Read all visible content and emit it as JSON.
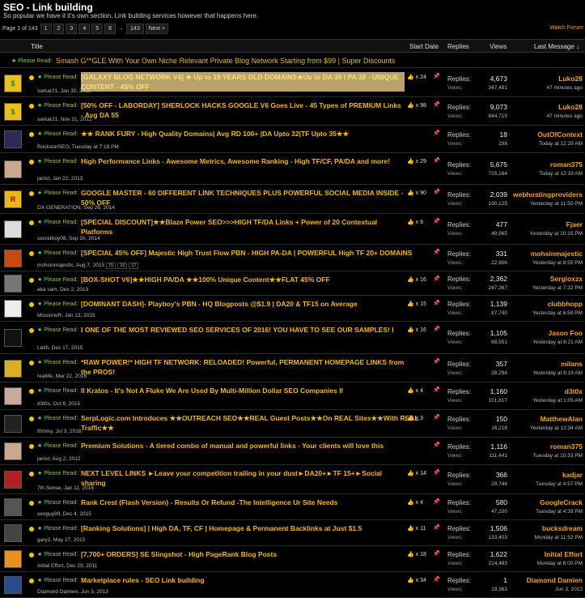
{
  "header": {
    "title": "SEO - Link building",
    "subtitle": "So popular we have it it's own section. Link building services however that happens here.",
    "pager_label": "Page 1 of 143",
    "pages": [
      "1",
      "2",
      "3",
      "4",
      "5",
      "6",
      "→",
      "143",
      "Next >"
    ],
    "watch": "Watch Forum"
  },
  "columns": {
    "title": "Title",
    "start": "Start Date",
    "replies": "Replies",
    "views": "Views",
    "last": "Last Message ↓"
  },
  "sticky_top": {
    "prefix": "Please Read:",
    "text": "Smash G**GLE With Your Own Niche Relevant Private Blog Network Starting from $99 | Super Discounts"
  },
  "labels": {
    "replies": "Replies:",
    "views": "Views:",
    "please_read": "Please Read:"
  },
  "threads": [
    {
      "title": "[GALAXY BLOG NETWORK V4] ★ Up to 19 YEARS OLD DOMAINS★Up to DA 39 | PA 38 - UNIQUE CONTENT - 45% OFF",
      "meta": "sarkar21, Jan 30, 2013",
      "likes": "x 24",
      "replies": "4,673",
      "views": "347,481",
      "last_user": "Luko28",
      "last_time": "47 minutes ago",
      "avatar": "$",
      "avatar_color": "#e8c21a",
      "highlight": true
    },
    {
      "title": "[50% OFF - LABORDAY] SHERLOCK HACKS GOOGLE V6 Goes Live - 45 Types of PREMIUM Links - Avg DA 55",
      "meta": "sarkar21, Nov 21, 2012",
      "likes": "x 98",
      "replies": "9,073",
      "views": "844,715",
      "last_user": "Luko28",
      "last_time": "47 minutes ago",
      "avatar": "$",
      "avatar_color": "#e8c21a",
      "highlight": false
    },
    {
      "title": "★★ RANK FURY - High Quality Domains| Avg RD 100+ |DA Upto 32|TF Upto 35★★",
      "meta": "RockstarSEO, Tuesday at 7:18 PM",
      "likes": "",
      "replies": "18",
      "views": "298",
      "last_user": "OutOfContext",
      "last_time": "Today at 12:29 AM",
      "avatar": "",
      "avatar_color": "#2a2a55",
      "highlight": false
    },
    {
      "title": "High Performance Links - Awesome Metrics, Awesome Ranking - High TF/CF, PA/DA and more!",
      "meta": "janist, Jan 22, 2013",
      "likes": "x 29",
      "replies": "5,675",
      "views": "715,164",
      "last_user": "roman375",
      "last_time": "Today at 12:19 AM",
      "avatar": "",
      "avatar_color": "#c9a890",
      "highlight": false
    },
    {
      "title": "GOOGLE MASTER - 60 DIFFERENT LINK TECHNIQUES PLUS POWERFUL SOCIAL MEDIA INSIDE - 50% OFF",
      "meta": "DX-GENERATION, Sep 26, 2014",
      "likes": "x 90",
      "replies": "2,039",
      "views": "190,125",
      "last_user": "webhostingproviders",
      "last_time": "Yesterday at 11:50 PM",
      "avatar": "R",
      "avatar_color": "#e8b81a",
      "highlight": false
    },
    {
      "title": "[SPECIAL DISCOUNT]★★Blaze Power SEO>>>HIGH TF/DA Links + Power of 20 Contextual Platforms",
      "meta": "secretboy08, Sep 20, 2014",
      "likes": "x 6",
      "replies": "477",
      "views": "49,965",
      "last_user": "Fjaer",
      "last_time": "Yesterday at 10:15 PM",
      "avatar": "",
      "avatar_color": "#ddd",
      "highlight": false
    },
    {
      "title": "[SPECIAL 45% OFF] Majestic High Trust Flow PBN - HIGH PA-DA | POWERFUL High TF 20+ DOMAINS",
      "meta": "mohsinmajestic, Aug 7, 2015",
      "meta_pages": [
        "15",
        "16",
        "17"
      ],
      "likes": "",
      "replies": "331",
      "views": "22,906",
      "last_user": "mohsinmajestic",
      "last_time": "Yesterday at 8:55 PM",
      "avatar": "",
      "avatar_color": "#c84a10",
      "highlight": false
    },
    {
      "title": "[BOX-SHOT V6]★★HIGH PA/DA ★★100% Unique Content★★FLAT 45% OFF",
      "meta": "aka sam, Dec 2, 2013",
      "likes": "x 16",
      "replies": "2,362",
      "views": "247,367",
      "last_user": "Sergioxzx",
      "last_time": "Yesterday at 7:32 PM",
      "avatar": "",
      "avatar_color": "#777",
      "highlight": false
    },
    {
      "title": "[DOMINANT DASH]- Playboy's PBN - HQ Blogposts @$1.9 | DA20 & TF15 on Average",
      "meta": "MissioneR, Jan 13, 2015",
      "likes": "x 15",
      "replies": "1,139",
      "views": "87,740",
      "last_user": "clubbhopp",
      "last_time": "Yesterday at 6:59 PM",
      "avatar": "",
      "avatar_color": "#eee",
      "highlight": false
    },
    {
      "title": "I ONE OF THE MOST REVIEWED SEO SERVICES OF 2016! YOU HAVE TO SEE OUR SAMPLES! I",
      "meta": "Leith, Dec 17, 2015",
      "likes": "x 16",
      "replies": "1,105",
      "views": "88,551",
      "last_user": "Jason Foo",
      "last_time": "Yesterday at 6:21 AM",
      "avatar": "",
      "avatar_color": "#111",
      "highlight": false
    },
    {
      "title": "*RAW POWER!* HIGH TF NETWORK: RELOADED! Powerful, PERMANENT HOMEPAGE LINKS from the PROS!",
      "meta": "reallife, Mar 22, 2016",
      "likes": "",
      "replies": "357",
      "views": "28,294",
      "last_user": "milans",
      "last_time": "Yesterday at 6:19 AM",
      "avatar": "",
      "avatar_color": "#d9b020",
      "highlight": false
    },
    {
      "title": "Il Kratos - It's Not A Fluke We Are Used By Multi-Million Dollar SEO Companies Il",
      "meta": "d3t0x, Oct 6, 2015",
      "likes": "x 4",
      "replies": "1,160",
      "views": "101,817",
      "last_user": "d3t0x",
      "last_time": "Yesterday at 1:05 AM",
      "avatar": "",
      "avatar_color": "#c9a8a0",
      "highlight": false
    },
    {
      "title": "SerpLogic.com Introduces ★★OUTREACH SEO★★REAL Guest Posts★★On REAL Sites★★With REAL Traffic★★",
      "meta": "t0mmy, Jul 3, 2016",
      "likes": "x 3",
      "replies": "150",
      "views": "16,218",
      "last_user": "MatthewAlan",
      "last_time": "Yesterday at 12:34 AM",
      "avatar": "",
      "avatar_color": "#222",
      "highlight": false
    },
    {
      "title": "Premium Solutions - A tiered combo of manual and powerful links - Your clients will love this",
      "meta": "janist, Aug 2, 2012",
      "likes": "",
      "replies": "1,116",
      "views": "111,441",
      "last_user": "roman375",
      "last_time": "Tuesday at 10:33 PM",
      "avatar": "",
      "avatar_color": "#c9a890",
      "highlight": false
    },
    {
      "title": "NEXT LEVEL LINKS ►Leave your competition trailing in your dust►DA20+►TF 15+►Social sharing",
      "meta": "7th Sense, Jan 11, 2016",
      "likes": "x 14",
      "replies": "366",
      "views": "29,746",
      "last_user": "kadjar",
      "last_time": "Tuesday at 4:57 PM",
      "avatar": "",
      "avatar_color": "#b02020",
      "highlight": false
    },
    {
      "title": "Rank Crest (Flash Version) - Results Or Refund -The Intelligence Ur Site Needs",
      "meta": "seoguy99, Dec 4, 2015",
      "likes": "x 4",
      "replies": "580",
      "views": "47,100",
      "last_user": "GoogleCrack",
      "last_time": "Tuesday at 4:39 PM",
      "avatar": "",
      "avatar_color": "#555",
      "highlight": false
    },
    {
      "title": "[Ranking Solutions] | High DA, TF, CF | Homepage & Permanent Backlinks at Just $1.5",
      "meta": "gary2, May 27, 2015",
      "likes": "x 11",
      "replies": "1,506",
      "views": "133,403",
      "last_user": "bucksdream",
      "last_time": "Monday at 11:52 PM",
      "avatar": "",
      "avatar_color": "#444",
      "highlight": false
    },
    {
      "title": "[7,700+ ORDERS] SE Slingshot - High PageRank Blog Posts",
      "meta": "Initial Effort, Dec 29, 2011",
      "likes": "x 18",
      "replies": "1,622",
      "views": "214,483",
      "last_user": "Initial Effort",
      "last_time": "Monday at 8:00 PM",
      "avatar": "",
      "avatar_color": "#e89020",
      "highlight": false
    },
    {
      "title": "Marketplace rules - SEO Link building",
      "meta": "Diamond Damien, Jun 3, 2013",
      "likes": "x 34",
      "replies": "1",
      "views": "19,363",
      "last_user": "Diamond Damien",
      "last_time": "Jun 3, 2013",
      "avatar": "",
      "avatar_color": "#2a4a8a",
      "highlight": false
    }
  ]
}
